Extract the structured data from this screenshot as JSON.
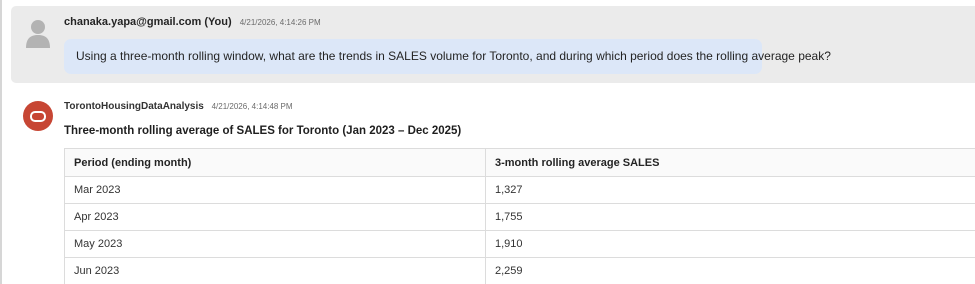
{
  "user_message": {
    "sender": "chanaka.yapa@gmail.com (You)",
    "timestamp": "4/21/2026, 4:14:26 PM",
    "text": "Using a three-month rolling window, what are the trends in SALES volume for Toronto, and during which period does the rolling average peak?"
  },
  "bot_message": {
    "sender": "TorontoHousingDataAnalysis",
    "timestamp": "4/21/2026, 4:14:48 PM",
    "title": "Three-month rolling average of SALES for Toronto (Jan 2023 – Dec 2025)",
    "table": {
      "headers": [
        "Period (ending month)",
        "3-month rolling average SALES"
      ],
      "rows": [
        [
          "Mar 2023",
          "1,327"
        ],
        [
          "Apr 2023",
          "1,755"
        ],
        [
          "May 2023",
          "1,910"
        ],
        [
          "Jun 2023",
          "2,259"
        ]
      ]
    }
  },
  "icons": {
    "user_avatar": "person-icon",
    "bot_avatar": "oracle-logo-icon"
  },
  "colors": {
    "user_bubble": "#dce7f8",
    "user_row_bg": "#ebebeb",
    "bot_avatar": "#c74634"
  }
}
